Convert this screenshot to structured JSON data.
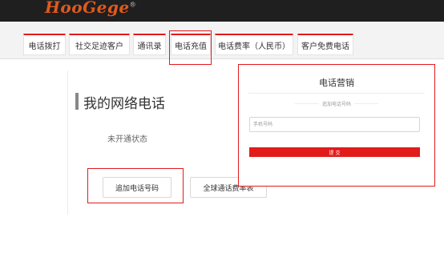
{
  "header": {
    "logo_text": "HooGege",
    "logo_mark": "®"
  },
  "tabs": [
    {
      "label": "电话拨打"
    },
    {
      "label": "社交足迹客户"
    },
    {
      "label": "通讯录"
    },
    {
      "label": "电话充值"
    },
    {
      "label": "电话费率（人民币）"
    },
    {
      "label": "客户免费电话"
    }
  ],
  "main": {
    "title": "我的网络电话",
    "status": "未开通状态",
    "buttons": {
      "add_number": "追加电话号码",
      "global_rates": "全球通话费率表"
    }
  },
  "popup": {
    "title": "电话营销",
    "subtitle": "追加电话号码",
    "phone_placeholder": "手机号码",
    "submit_label": "提 交"
  },
  "colors": {
    "accent": "#e21b1b",
    "logo": "#e05a1e",
    "topbar": "#1f1f1f"
  }
}
